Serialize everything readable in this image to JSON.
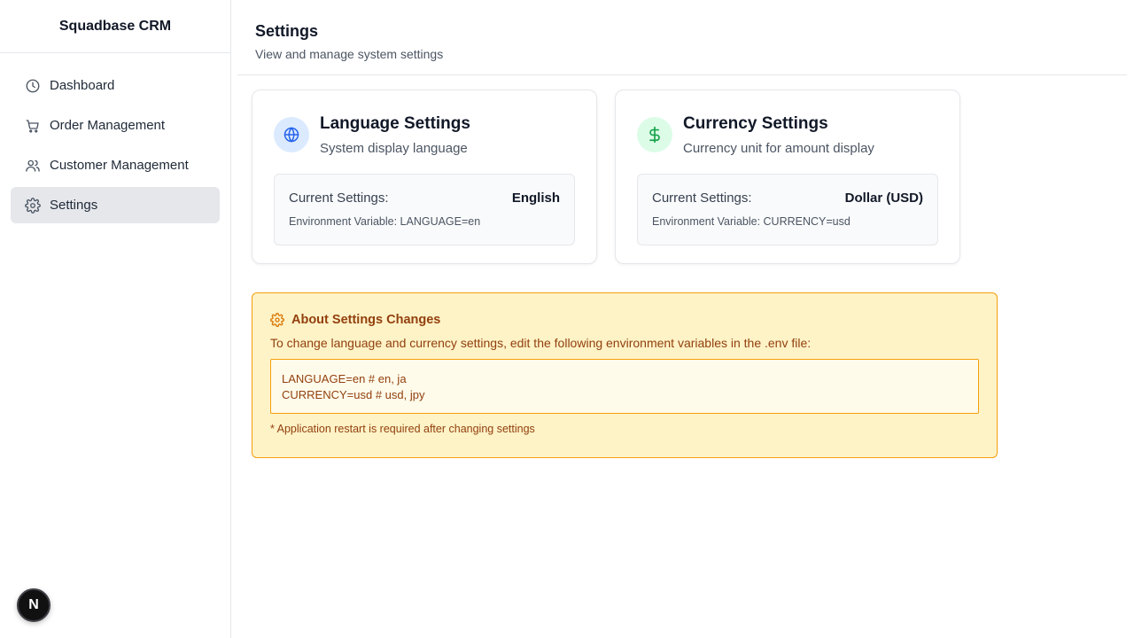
{
  "app": {
    "title": "Squadbase CRM"
  },
  "sidebar": {
    "items": [
      {
        "label": "Dashboard",
        "icon": "clock-icon",
        "active": false
      },
      {
        "label": "Order Management",
        "icon": "cart-icon",
        "active": false
      },
      {
        "label": "Customer Management",
        "icon": "users-icon",
        "active": false
      },
      {
        "label": "Settings",
        "icon": "gear-icon",
        "active": true
      }
    ]
  },
  "badge": {
    "letter": "N"
  },
  "page": {
    "title": "Settings",
    "subtitle": "View and manage system settings"
  },
  "cards": {
    "language": {
      "title": "Language Settings",
      "description": "System display language",
      "current_label": "Current Settings:",
      "current_value": "English",
      "env_var": "Environment Variable: LANGUAGE=en",
      "icon": "globe-icon"
    },
    "currency": {
      "title": "Currency Settings",
      "description": "Currency unit for amount display",
      "current_label": "Current Settings:",
      "current_value": "Dollar (USD)",
      "env_var": "Environment Variable: CURRENCY=usd",
      "icon": "dollar-icon"
    }
  },
  "notice": {
    "title": "About Settings Changes",
    "text": "To change language and currency settings, edit the following environment variables in the .env file:",
    "code_lines": [
      "LANGUAGE=en # en, ja",
      "CURRENCY=usd # usd, jpy"
    ],
    "footnote": "* Application restart is required after changing settings"
  },
  "colors": {
    "accent_blue": "#2563eb",
    "accent_green": "#16a34a",
    "warning_bg": "#fef3c7",
    "warning_border": "#f59e0b",
    "warning_text": "#92400e"
  }
}
